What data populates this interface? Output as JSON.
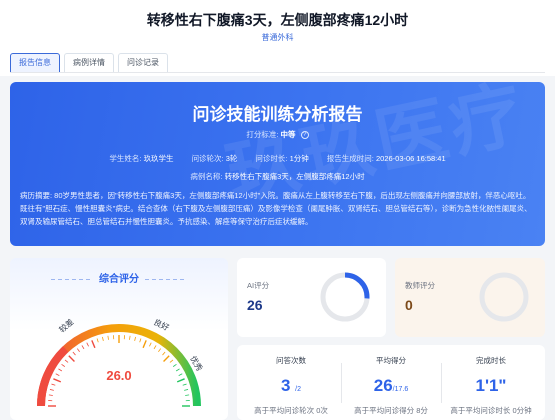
{
  "page": {
    "title": "转移性右下腹痛3天，左侧腹部疼痛12小时",
    "department": "普通外科"
  },
  "tabs": [
    {
      "label": "报告信息"
    },
    {
      "label": "病例详情"
    },
    {
      "label": "问诊记录"
    }
  ],
  "report": {
    "title": "问诊技能训练分析报告",
    "level_label": "打分标准:",
    "level_value": "中等",
    "student_label": "学生姓名:",
    "student_value": "玖玖学生",
    "rounds_label": "问诊轮次:",
    "rounds_value": "3轮",
    "duration_label": "问诊时长:",
    "duration_value": "1分钟",
    "time_label": "报告生成时间:",
    "time_value": "2026-03-06 16:58:41",
    "case_label": "病例名称:",
    "case_value": "转移性右下腹痛3天，左侧腹部疼痛12小时",
    "summary": "病历摘要: 80岁男性患者，因\"转移性右下腹痛3天，左侧腹部疼痛12小时\"入院。腹痛从左上腹转移至右下腹，后出现左侧腹痛并向腰部放射，伴恶心呕吐。既往有\"胆石症、慢性胆囊炎\"病史。结合查体（右下腹及左侧腹部压痛）及影像学检查（阑尾肿胀、双肾结石、胆总管结石等），诊断为急性化脓性阑尾炎、双肾及输尿管结石、胆总管结石并慢性胆囊炎。予抗感染、解痉等保守治疗后症状缓解。",
    "watermark": "玖玖医疗"
  },
  "score": {
    "title": "综合评分",
    "value": "26.0",
    "labels": {
      "poor": "较差",
      "good": "良好",
      "excellent": "优秀"
    },
    "level": 0.26
  },
  "ai": {
    "label": "AI评分",
    "value": "26",
    "level": 0.26
  },
  "teacher": {
    "label": "教师评分",
    "value": "0",
    "level": 0
  },
  "stats": {
    "questions": {
      "label": "问答次数",
      "value": "3",
      "suffix": "/2",
      "foot": "高于平均问诊轮次 0次"
    },
    "avg_score": {
      "label": "平均得分",
      "value": "26",
      "suffix": "/17.6",
      "foot": "高于平均问诊得分 8分"
    },
    "time": {
      "label": "完成时长",
      "value": "1'1\"",
      "foot": "高于平均问诊时长 0分钟"
    }
  },
  "colors": {
    "accent": "#2e63e8",
    "danger": "#ef4b3f",
    "gauge_green": "#22c55e"
  }
}
